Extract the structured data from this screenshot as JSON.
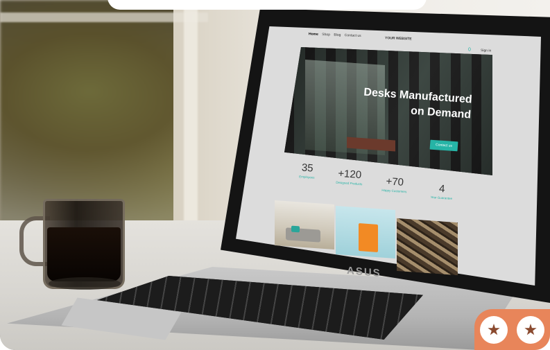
{
  "website": {
    "nav": {
      "links": [
        "Home",
        "Shop",
        "Blog",
        "Contact us"
      ],
      "logo": "YOUR WEBSITE",
      "cart": "0",
      "signin": "Sign in"
    },
    "hero": {
      "title_line1": "Desks Manufactured",
      "title_line2": "on Demand",
      "button": "Contact us"
    },
    "stats": [
      {
        "value": "35",
        "label": "Employees"
      },
      {
        "value": "+120",
        "label": "Designed Products"
      },
      {
        "value": "+70",
        "label": "Happy Customers"
      },
      {
        "value": "4",
        "label": "Year Guarantee"
      }
    ]
  },
  "laptop": {
    "brand": "ASUS"
  },
  "badges": {
    "icons": [
      "star-icon",
      "star-icon"
    ]
  },
  "colors": {
    "accent": "#26b4a6",
    "badge": "#e8855a"
  }
}
